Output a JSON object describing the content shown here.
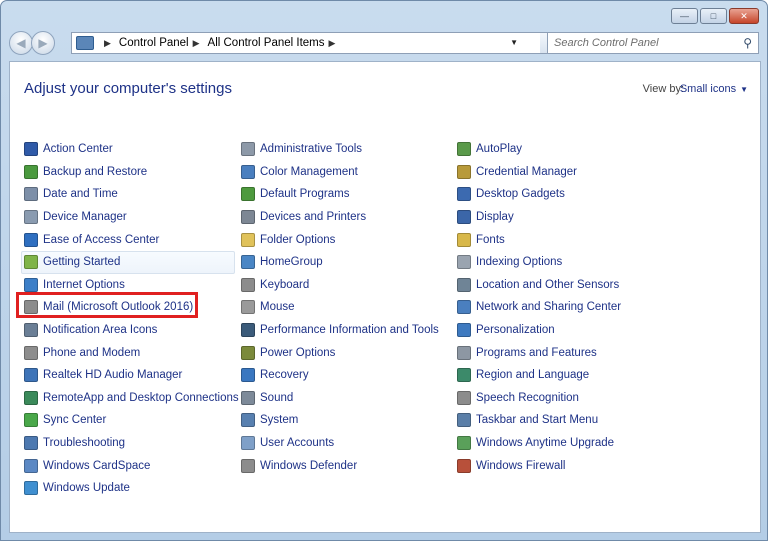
{
  "window": {
    "caption_buttons": [
      "minimize",
      "maximize",
      "close"
    ],
    "close_color": "#c6452a"
  },
  "navbar": {
    "breadcrumb": [
      "Control Panel",
      "All Control Panel Items"
    ],
    "search_placeholder": "Search Control Panel"
  },
  "header": {
    "title": "Adjust your computer's settings",
    "view_by_label": "View by:",
    "view_by_value": "Small icons"
  },
  "columns": [
    [
      {
        "label": "Action Center",
        "icon": "flag-icon",
        "color": "#2f5aa8"
      },
      {
        "label": "Backup and Restore",
        "icon": "backup-icon",
        "color": "#4b9a3f"
      },
      {
        "label": "Date and Time",
        "icon": "clock-icon",
        "color": "#7d8fa8"
      },
      {
        "label": "Device Manager",
        "icon": "device-manager-icon",
        "color": "#8a9bb0"
      },
      {
        "label": "Ease of Access Center",
        "icon": "ease-of-access-icon",
        "color": "#2f6fc0"
      },
      {
        "label": "Getting Started",
        "icon": "getting-started-icon",
        "color": "#7fb449"
      },
      {
        "label": "Internet Options",
        "icon": "globe-icon",
        "color": "#3c7fc8"
      },
      {
        "label": "Mail (Microsoft Outlook 2016)",
        "icon": "mail-icon",
        "color": "#8c8c8c"
      },
      {
        "label": "Notification Area Icons",
        "icon": "notification-icon",
        "color": "#6b7f96"
      },
      {
        "label": "Phone and Modem",
        "icon": "phone-icon",
        "color": "#8d8d8d"
      },
      {
        "label": "Realtek HD Audio Manager",
        "icon": "audio-icon",
        "color": "#3e74b8"
      },
      {
        "label": "RemoteApp and Desktop Connections",
        "icon": "remote-icon",
        "color": "#3b8a5a"
      },
      {
        "label": "Sync Center",
        "icon": "sync-icon",
        "color": "#4aa84a"
      },
      {
        "label": "Troubleshooting",
        "icon": "troubleshoot-icon",
        "color": "#4d79b0"
      },
      {
        "label": "Windows CardSpace",
        "icon": "cardspace-icon",
        "color": "#5b88c4"
      },
      {
        "label": "Windows Update",
        "icon": "windows-update-icon",
        "color": "#3f8fd0"
      }
    ],
    [
      {
        "label": "Administrative Tools",
        "icon": "admin-tools-icon",
        "color": "#8d99a8"
      },
      {
        "label": "Color Management",
        "icon": "color-icon",
        "color": "#4a7fbf"
      },
      {
        "label": "Default Programs",
        "icon": "default-programs-icon",
        "color": "#4e9a3e"
      },
      {
        "label": "Devices and Printers",
        "icon": "printer-icon",
        "color": "#7d8794"
      },
      {
        "label": "Folder Options",
        "icon": "folder-icon",
        "color": "#e0c25a"
      },
      {
        "label": "HomeGroup",
        "icon": "homegroup-icon",
        "color": "#4a86c5"
      },
      {
        "label": "Keyboard",
        "icon": "keyboard-icon",
        "color": "#8c8c8c"
      },
      {
        "label": "Mouse",
        "icon": "mouse-icon",
        "color": "#9a9a9a"
      },
      {
        "label": "Performance Information and Tools",
        "icon": "performance-icon",
        "color": "#3b5b7a"
      },
      {
        "label": "Power Options",
        "icon": "power-icon",
        "color": "#7b8a3b"
      },
      {
        "label": "Recovery",
        "icon": "recovery-icon",
        "color": "#3a77c0"
      },
      {
        "label": "Sound",
        "icon": "sound-icon",
        "color": "#7d8a99"
      },
      {
        "label": "System",
        "icon": "system-icon",
        "color": "#5880b0"
      },
      {
        "label": "User Accounts",
        "icon": "user-accounts-icon",
        "color": "#7fa0c8"
      },
      {
        "label": "Windows Defender",
        "icon": "defender-icon",
        "color": "#8c8c8c"
      }
    ],
    [
      {
        "label": "AutoPlay",
        "icon": "autoplay-icon",
        "color": "#5a9a4a"
      },
      {
        "label": "Credential Manager",
        "icon": "credential-icon",
        "color": "#b89a3a"
      },
      {
        "label": "Desktop Gadgets",
        "icon": "gadgets-icon",
        "color": "#3c6ab0"
      },
      {
        "label": "Display",
        "icon": "display-icon",
        "color": "#3b66a8"
      },
      {
        "label": "Fonts",
        "icon": "fonts-icon",
        "color": "#d8b84a"
      },
      {
        "label": "Indexing Options",
        "icon": "indexing-icon",
        "color": "#9aa4b0"
      },
      {
        "label": "Location and Other Sensors",
        "icon": "sensors-icon",
        "color": "#6f8496"
      },
      {
        "label": "Network and Sharing Center",
        "icon": "network-icon",
        "color": "#4a7fbf"
      },
      {
        "label": "Personalization",
        "icon": "personalization-icon",
        "color": "#3e7ac0"
      },
      {
        "label": "Programs and Features",
        "icon": "programs-icon",
        "color": "#8d97a3"
      },
      {
        "label": "Region and Language",
        "icon": "region-icon",
        "color": "#3c8a6a"
      },
      {
        "label": "Speech Recognition",
        "icon": "microphone-icon",
        "color": "#8c8c8c"
      },
      {
        "label": "Taskbar and Start Menu",
        "icon": "taskbar-icon",
        "color": "#5b7fa8"
      },
      {
        "label": "Windows Anytime Upgrade",
        "icon": "anytime-upgrade-icon",
        "color": "#5aa05a"
      },
      {
        "label": "Windows Firewall",
        "icon": "firewall-icon",
        "color": "#b8503a"
      }
    ]
  ],
  "highlighted_item": "Mail (Microsoft Outlook 2016)",
  "highlight_color": "#e02020"
}
